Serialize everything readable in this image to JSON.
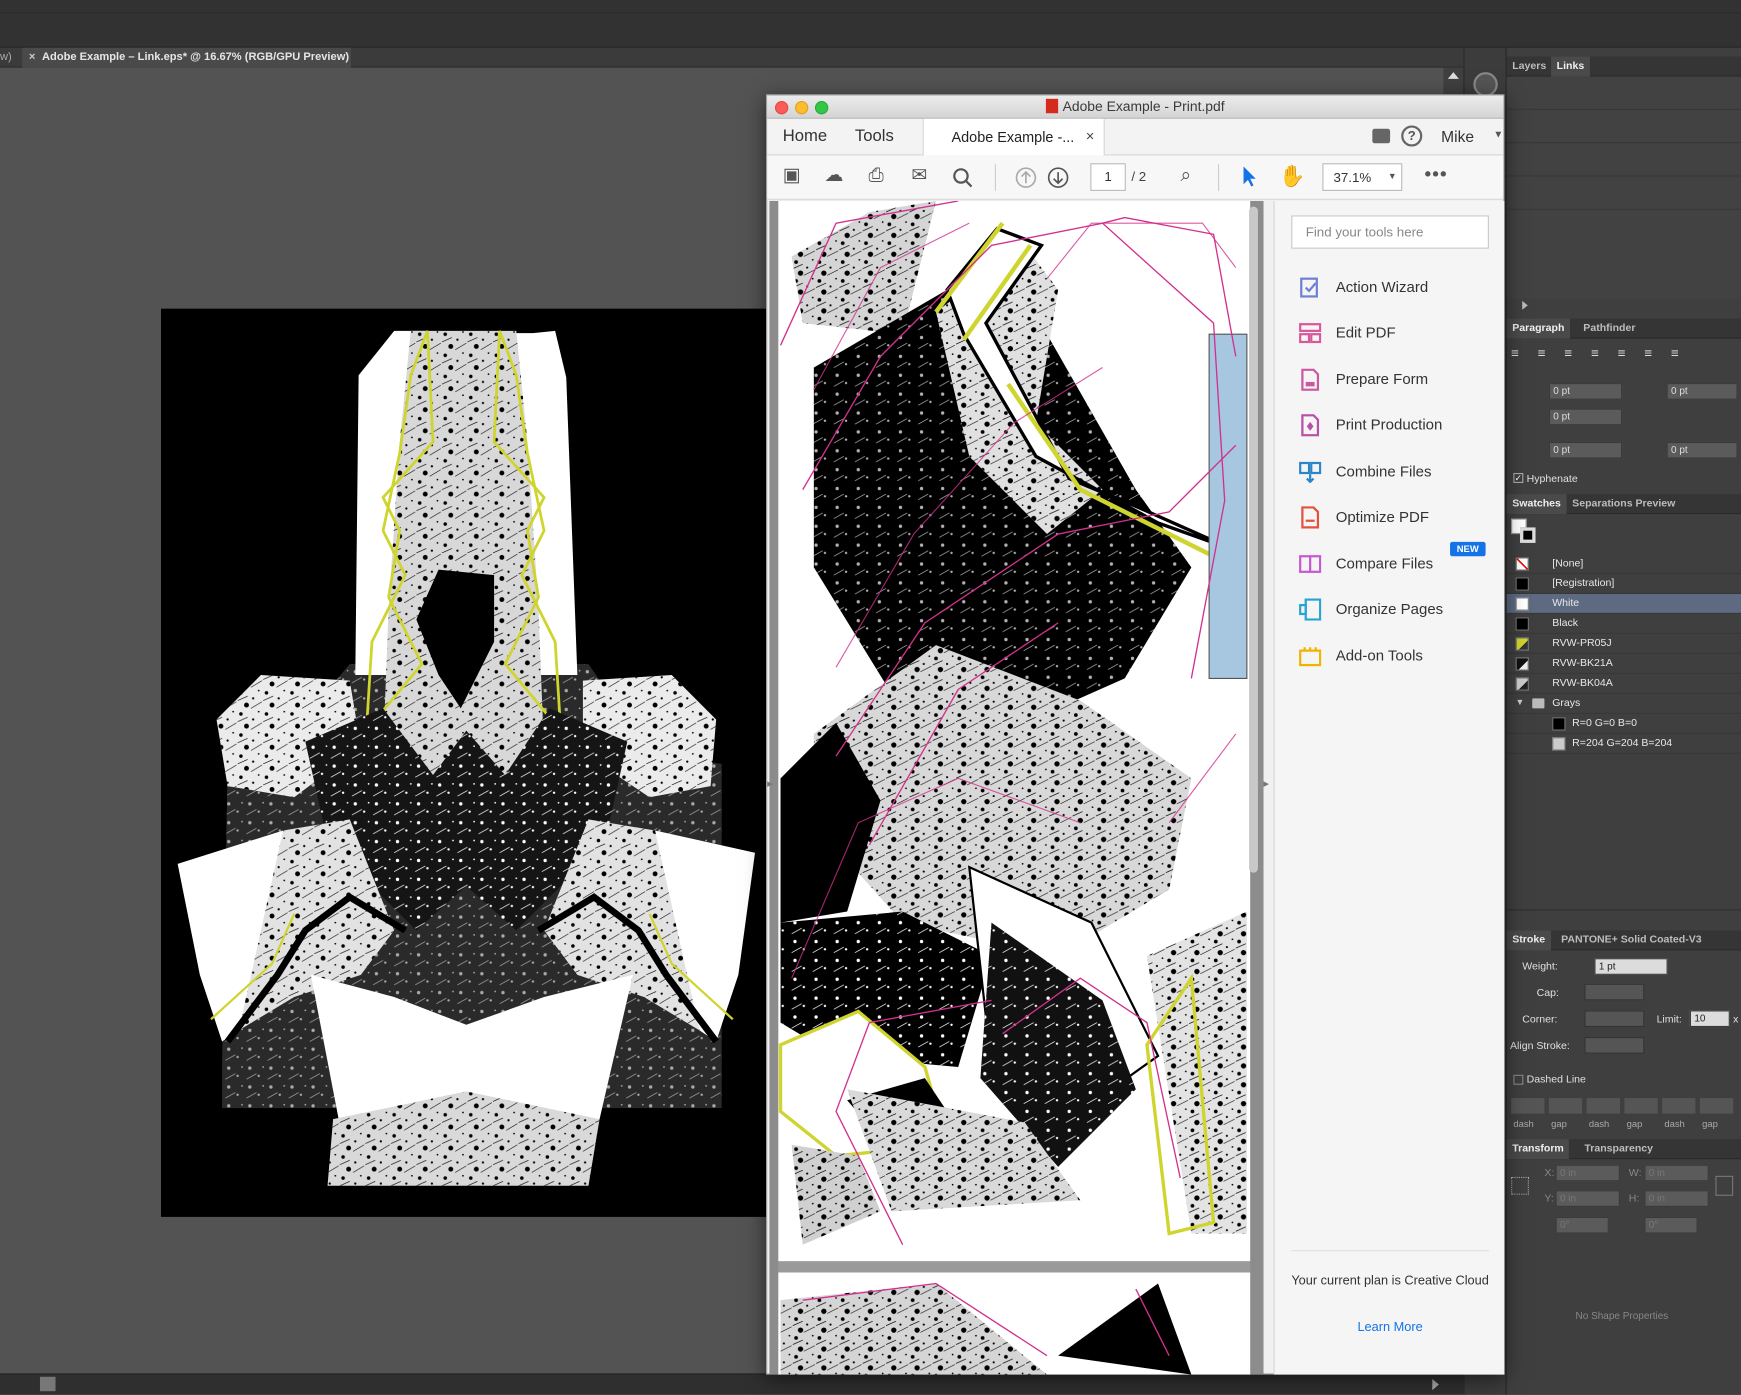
{
  "illustrator": {
    "doc_tab_prev_fragment": "w)",
    "doc_tab_close": "×",
    "doc_tab_title": "Adobe Example – Link.eps* @ 16.67% (RGB/GPU Preview)"
  },
  "panels": {
    "layers_tabs": [
      "Layers",
      "Links"
    ],
    "paragraph_tabs": [
      "Paragraph",
      "Pathfinder"
    ],
    "indent_left": "0 pt",
    "indent_right": "0 pt",
    "first_line_indent": "0 pt",
    "space_before": "0 pt",
    "space_after": "0 pt",
    "hyphenate_label": "Hyphenate",
    "swatches_tabs": [
      "Swatches",
      "Separations Preview"
    ],
    "swatches": [
      {
        "name": "[None]",
        "color": "none"
      },
      {
        "name": "[Registration]",
        "color": "#000000"
      },
      {
        "name": "White",
        "color": "#ffffff"
      },
      {
        "name": "Black",
        "color": "#000000"
      },
      {
        "name": "RVW-PR05J",
        "color": "#cfd42e"
      },
      {
        "name": "RVW-BK21A",
        "color": "#111111"
      },
      {
        "name": "RVW-BK04A",
        "color": "#cccccc"
      }
    ],
    "swatch_group": "Grays",
    "group_swatches": [
      {
        "name": "R=0 G=0 B=0",
        "color": "#000000"
      },
      {
        "name": "R=204 G=204 B=204",
        "color": "#cccccc"
      }
    ],
    "stroke_tabs": [
      "Stroke",
      "PANTONE+ Solid Coated-V3"
    ],
    "weight_label": "Weight:",
    "weight_value": "1 pt",
    "cap_label": "Cap:",
    "corner_label": "Corner:",
    "limit_label": "Limit:",
    "limit_value": "10",
    "limit_suffix": "x",
    "align_stroke_label": "Align Stroke:",
    "dashed_line_label": "Dashed Line",
    "dash_labels": [
      "dash",
      "gap",
      "dash",
      "gap",
      "dash",
      "gap"
    ],
    "transform_tabs": [
      "Transform",
      "Transparency"
    ],
    "x_label": "X:",
    "y_label": "Y:",
    "w_label": "W:",
    "h_label": "H:",
    "x_value": "0 in",
    "y_value": "0 in",
    "w_value": "0 in",
    "h_value": "0 in",
    "angle_value": "0°",
    "shear_value": "0°",
    "no_shape": "No Shape Properties"
  },
  "acrobat": {
    "window_title": "Adobe Example - Print.pdf",
    "nav_home": "Home",
    "nav_tools": "Tools",
    "doc_tab": "Adobe Example -...",
    "doc_tab_close": "×",
    "user": "Mike",
    "page_current": "1",
    "page_total": "/ 2",
    "zoom": "37.1%",
    "search_placeholder": "Find your tools here",
    "tools": [
      {
        "label": "Action Wizard",
        "color": "#6f7fd6"
      },
      {
        "label": "Edit PDF",
        "color": "#d9589c"
      },
      {
        "label": "Prepare Form",
        "color": "#c95aa0"
      },
      {
        "label": "Print Production",
        "color": "#b94fa8"
      },
      {
        "label": "Combine Files",
        "color": "#2a86c9"
      },
      {
        "label": "Optimize PDF",
        "color": "#e2523c"
      },
      {
        "label": "Compare Files",
        "color": "#c45ad0"
      },
      {
        "label": "Organize Pages",
        "color": "#27a4d3"
      },
      {
        "label": "Add-on Tools",
        "color": "#f0b400"
      }
    ],
    "new_badge": "NEW",
    "plan_text": "Your current plan is Creative Cloud",
    "learn_more": "Learn More"
  },
  "colors": {
    "accent": "#1473e6",
    "highlight_yellow": "#cfd42e",
    "magenta_line": "#d2308c"
  }
}
